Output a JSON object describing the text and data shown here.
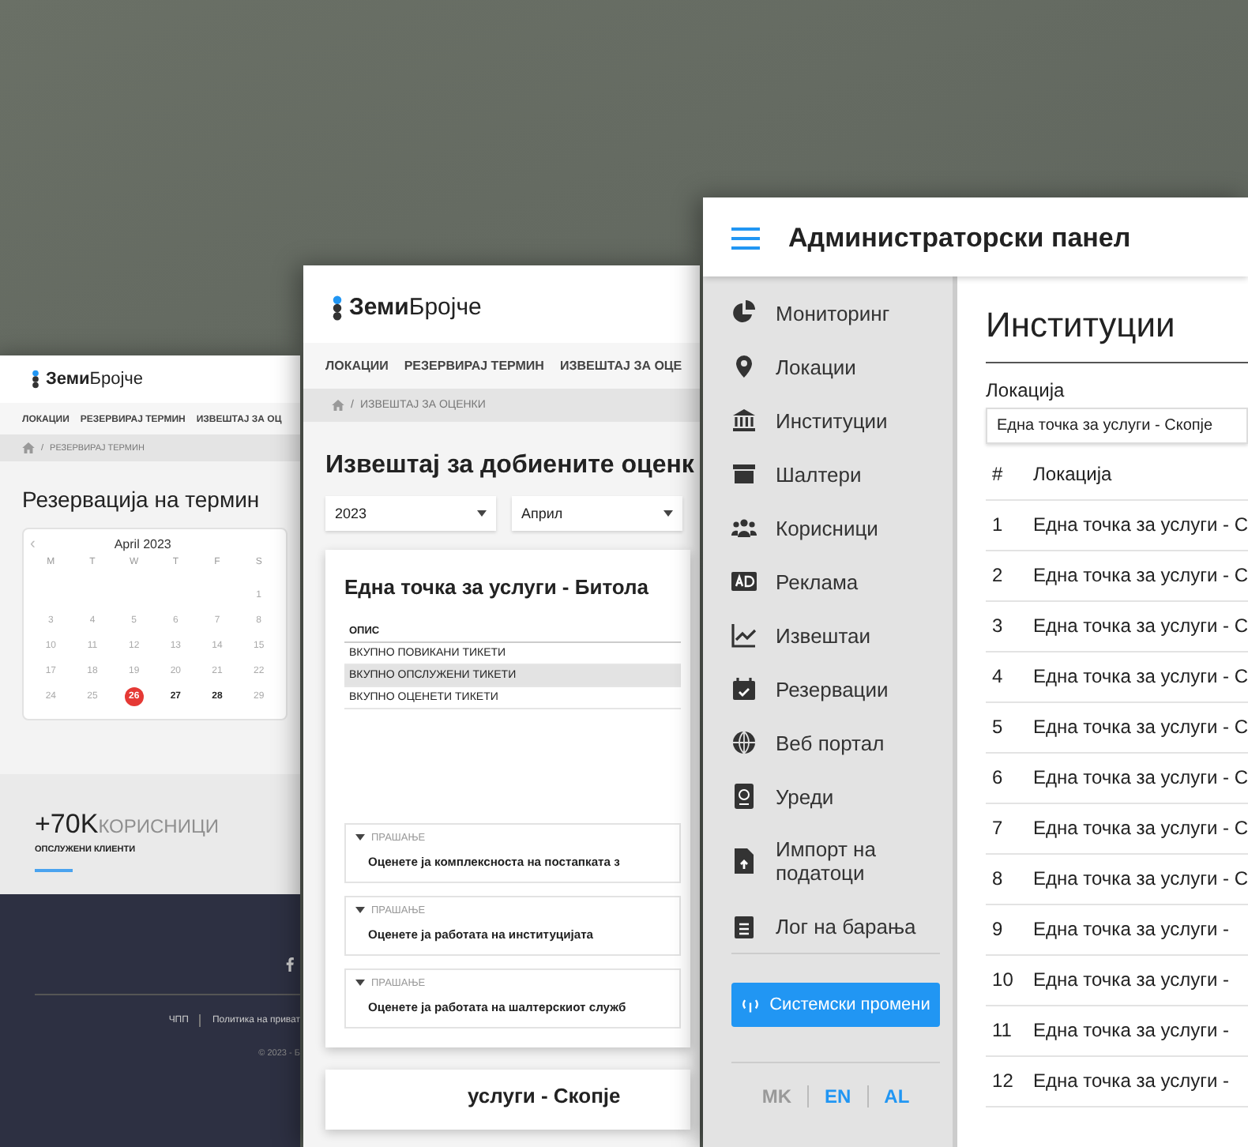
{
  "booking_page": {
    "logo": "**Земи**Бројче",
    "nav": [
      "ЛОКАЦИИ",
      "РЕЗЕРВИРАЈ ТЕРМИН",
      "ИЗВЕШТАЈ ЗА ОЦ"
    ],
    "separator": "/",
    "breadcrumb": "РЕЗЕРВИРАЈ ТЕРМИН",
    "title": "Резервација на термин",
    "calendar": {
      "prev": "‹",
      "month": "April 2023",
      "weekdays": [
        "M",
        "T",
        "W",
        "T",
        "F",
        "S"
      ],
      "weeks": [
        [
          {
            "d": "1",
            "selected": false,
            "available": false
          }
        ],
        [
          {
            "d": "3",
            "selected": false,
            "available": false
          },
          {
            "d": "4",
            "selected": false,
            "available": false
          },
          {
            "d": "5",
            "selected": false,
            "available": false
          },
          {
            "d": "6",
            "selected": false,
            "available": false
          },
          {
            "d": "7",
            "selected": false,
            "available": false
          },
          {
            "d": "8",
            "selected": false,
            "available": false
          }
        ],
        [
          {
            "d": "10",
            "selected": false,
            "available": false
          },
          {
            "d": "11",
            "selected": false,
            "available": false
          },
          {
            "d": "12",
            "selected": false,
            "available": false
          },
          {
            "d": "13",
            "selected": false,
            "available": false
          },
          {
            "d": "14",
            "selected": false,
            "available": false
          },
          {
            "d": "15",
            "selected": false,
            "available": false
          }
        ],
        [
          {
            "d": "17",
            "selected": false,
            "available": false
          },
          {
            "d": "18",
            "selected": false,
            "available": false
          },
          {
            "d": "19",
            "selected": false,
            "available": false
          },
          {
            "d": "20",
            "selected": false,
            "available": false
          },
          {
            "d": "21",
            "selected": false,
            "available": false
          },
          {
            "d": "22",
            "selected": false,
            "available": false
          }
        ],
        [
          {
            "d": "24",
            "selected": false,
            "available": false
          },
          {
            "d": "25",
            "selected": false,
            "available": false
          },
          {
            "d": "26",
            "selected": true,
            "available": true
          },
          {
            "d": "27",
            "selected": false,
            "available": true
          },
          {
            "d": "28",
            "selected": false,
            "available": true
          },
          {
            "d": "29",
            "selected": false,
            "available": false
          }
        ]
      ]
    },
    "stat": {
      "value": "+70K",
      "unit": "КОРИСНИЦИ",
      "caption": "ОПСЛУЖЕНИ КЛИЕНТИ"
    },
    "footer": {
      "links": [
        "ЧПП",
        "Политика на приват"
      ],
      "copyright": "© 2023 - Б"
    }
  },
  "report_page": {
    "logo": "**Земи**Бројче",
    "nav": [
      "ЛОКАЦИИ",
      "РЕЗЕРВИРАЈ ТЕРМИН",
      "ИЗВЕШТАЈ ЗА ОЦЕ"
    ],
    "separator": "/",
    "breadcrumb": "ИЗВЕШТАЈ ЗА ОЦЕНКИ",
    "title": "Извештај за добиените оценк",
    "filters": [
      "2023",
      "Април"
    ],
    "card": {
      "title": "Една точка за услуги - Битола",
      "column": "ОПИС",
      "rows": [
        {
          "text": "ВКУПНО ПОВИКАНИ ТИКЕТИ",
          "selected": false
        },
        {
          "text": "ВКУПНО ОПСЛУЖЕНИ ТИКЕТИ",
          "selected": true
        },
        {
          "text": "ВКУПНО ОЦЕНЕТИ ТИКЕТИ",
          "selected": false
        }
      ],
      "questions": [
        {
          "label": "ПРАШАЊЕ",
          "text": "Оценете ја комплексноста на постапката з"
        },
        {
          "label": "ПРАШАЊЕ",
          "text": "Оценете ја работата на институцијата"
        },
        {
          "label": "ПРАШАЊЕ",
          "text": "Оценете ја работата на шалтерскиот служб"
        }
      ]
    },
    "next_card_title": "услуги - Скопје"
  },
  "admin_panel": {
    "title": "Администраторски панел",
    "sidebar": [
      "Мониторинг",
      "Локации",
      "Институции",
      "Шалтери",
      "Корисници",
      "Реклама",
      "Извештаи",
      "Резервации",
      "Веб портал",
      "Уреди",
      "Импорт на податоци",
      "Лог на барања"
    ],
    "button": "Системски промени",
    "languages": [
      {
        "label": "MK",
        "selected": true
      },
      {
        "label": "EN",
        "selected": false
      },
      {
        "label": "AL",
        "selected": false
      }
    ],
    "heading": "Институции",
    "field_label": "Локација",
    "field_value": "Една точка за услуги - Скопје",
    "columns": [
      "#",
      "Локација"
    ],
    "rows": [
      [
        "1",
        "Една точка за услуги - С"
      ],
      [
        "2",
        "Една точка за услуги - С"
      ],
      [
        "3",
        "Една точка за услуги - С"
      ],
      [
        "4",
        "Една точка за услуги - С"
      ],
      [
        "5",
        "Една точка за услуги - С"
      ],
      [
        "6",
        "Една точка за услуги - С"
      ],
      [
        "7",
        "Една точка за услуги - С"
      ],
      [
        "8",
        "Една точка за услуги - С"
      ],
      [
        "9",
        "Една точка за услуги -"
      ],
      [
        "10",
        "Една точка за услуги -"
      ],
      [
        "11",
        "Една точка за услуги -"
      ],
      [
        "12",
        "Една точка за услуги -"
      ]
    ]
  }
}
